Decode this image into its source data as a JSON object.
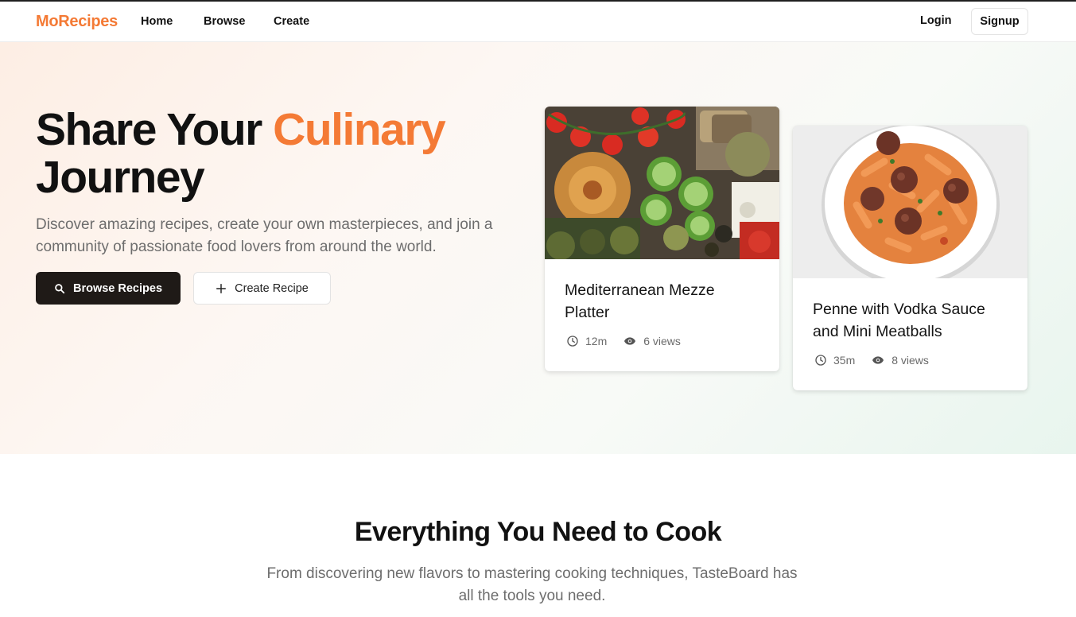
{
  "colors": {
    "brand": "#f47a35",
    "primary_button": "#1f1a17"
  },
  "nav": {
    "logo": "MoRecipes",
    "links": [
      "Home",
      "Browse",
      "Create"
    ],
    "login": "Login",
    "signup": "Signup"
  },
  "hero": {
    "title_part1": "Share Your ",
    "title_accent": "Culinary",
    "title_part2": "Journey",
    "subtitle": "Discover amazing recipes, create your own masterpieces, and join a community of passionate food lovers from around the world.",
    "browse_button": "Browse Recipes",
    "create_button": "Create Recipe"
  },
  "cards": [
    {
      "title": "Mediterranean Mezze Platter",
      "time": "12m",
      "views": "6 views"
    },
    {
      "title": "Penne with Vodka Sauce and Mini Meatballs",
      "time": "35m",
      "views": "8 views"
    }
  ],
  "features": {
    "title": "Everything You Need to Cook",
    "subtitle": "From discovering new flavors to mastering cooking techniques, TasteBoard has all the tools you need."
  }
}
